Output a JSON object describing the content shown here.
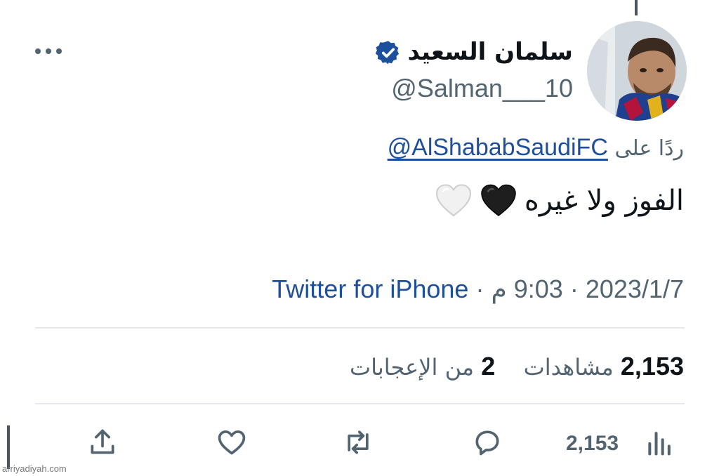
{
  "tweet": {
    "display_name": "سلمان السعيد",
    "username": "@Salman___10",
    "reply_prefix": "ردًا على",
    "reply_to_handle": "@AlShababSaudiFC",
    "text": "الفوز ولا غيره",
    "emojis": [
      "black-heart",
      "white-heart"
    ],
    "date": "2023/1/7",
    "time": "9:03 م",
    "source": "Twitter for iPhone",
    "separator": "·"
  },
  "stats": {
    "views_count": "2,153",
    "views_label": "مشاهدات",
    "likes_count": "2",
    "likes_label": "من الإعجابات"
  },
  "actions": {
    "views_count": "2,153",
    "icons": [
      "views-icon",
      "reply-icon",
      "retweet-icon",
      "like-icon",
      "share-icon"
    ]
  },
  "watermark": "arriyadiyah.com",
  "colors": {
    "link": "#1d4f9c",
    "secondary_text": "#536471",
    "verified": "#1d4f9c",
    "divider": "#e6e9eb"
  }
}
